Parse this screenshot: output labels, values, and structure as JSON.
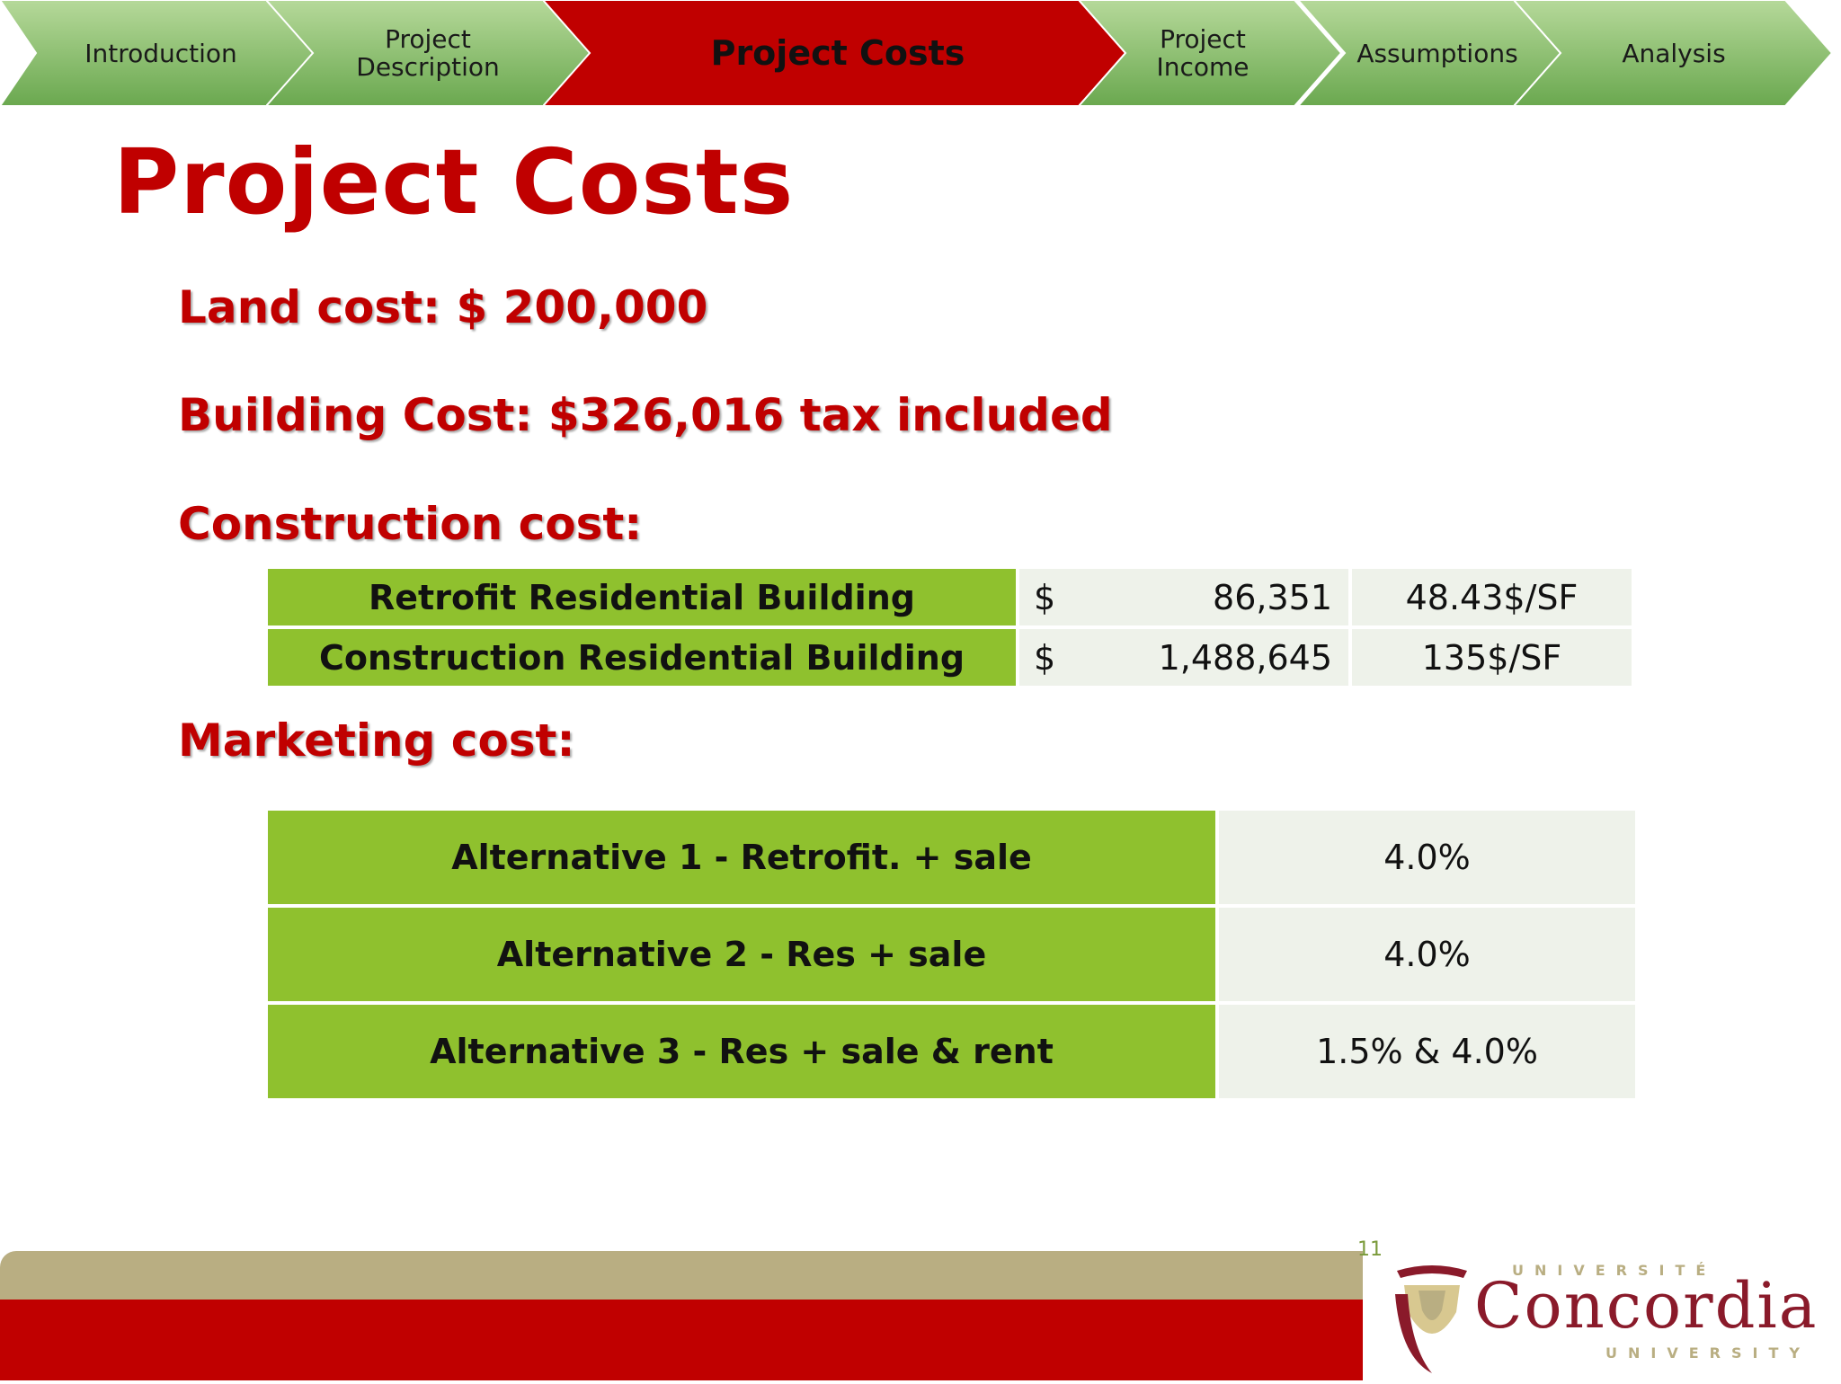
{
  "nav": {
    "steps": [
      {
        "label": "Introduction",
        "active": false
      },
      {
        "label": "Project\nDescription",
        "active": false
      },
      {
        "label": "Project Costs",
        "active": true
      },
      {
        "label": "Project\nIncome",
        "active": false
      },
      {
        "label": "Assumptions",
        "active": false
      },
      {
        "label": "Analysis",
        "active": false
      }
    ],
    "colors": {
      "inactive_top": "#a9d18e",
      "inactive_bottom": "#6aa84f",
      "active": "#c00000"
    }
  },
  "title": "Project Costs",
  "land_cost": "Land cost: $ 200,000",
  "building_cost": "Building Cost: $326,016 tax included",
  "construction": {
    "heading": "Construction cost:",
    "rows": [
      {
        "label": "Retrofit Residential Building",
        "currency": "$",
        "amount": "86,351",
        "rate": "48.43$/SF"
      },
      {
        "label": "Construction Residential Building",
        "currency": "$",
        "amount": "1,488,645",
        "rate": "135$/SF"
      }
    ]
  },
  "marketing": {
    "heading": "Marketing cost:",
    "rows": [
      {
        "label": "Alternative 1 - Retrofit. + sale",
        "value": "4.0%"
      },
      {
        "label": "Alternative 2 - Res + sale",
        "value": "4.0%"
      },
      {
        "label": "Alternative 3 - Res + sale & rent",
        "value": "1.5% & 4.0%"
      }
    ]
  },
  "footer": {
    "page_number": "11",
    "logo_word": "Concordia",
    "logo_fr": "UNIVERSITÉ",
    "logo_en": "UNIVERSITY"
  },
  "colors": {
    "accent_red": "#c00000",
    "table_green": "#8fc12e",
    "table_light": "#eef2ea",
    "footer_tan": "#b9ae82"
  }
}
